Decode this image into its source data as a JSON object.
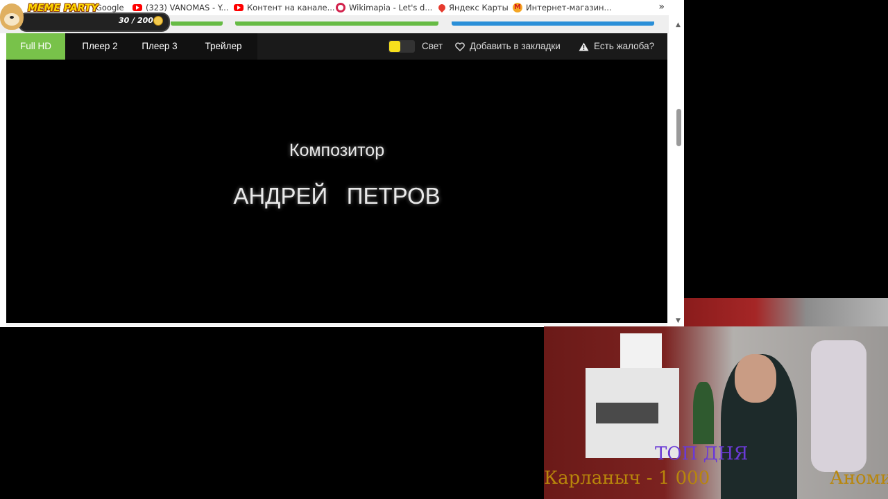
{
  "bookmarks": [
    {
      "label": "Google",
      "icon": "google-icon"
    },
    {
      "label": "(323) VANOMAS - Y...",
      "icon": "youtube-icon"
    },
    {
      "label": "Контент на канале...",
      "icon": "youtube-icon"
    },
    {
      "label": "Wikimapia - Let's d...",
      "icon": "wikimapia-icon"
    },
    {
      "label": "Яндекс Карты",
      "icon": "map-pin-icon"
    },
    {
      "label": "Интернет-магазин...",
      "icon": "store-icon"
    }
  ],
  "more_bookmarks_icon": "»",
  "meme_party": {
    "title": "MEME PARTY",
    "progress": "30 / 200"
  },
  "player_tabs": [
    {
      "label": "Full HD",
      "active": true
    },
    {
      "label": "Плеер 2",
      "active": false
    },
    {
      "label": "Плеер 3",
      "active": false
    },
    {
      "label": "Трейлер",
      "active": false
    }
  ],
  "controls": {
    "light_label": "Свет",
    "bookmark_label": "Добавить в закладки",
    "complaint_label": "Есть жалоба?"
  },
  "video": {
    "line1": "Композитор",
    "line2": "АНДРЕЙ   ПЕТРОВ"
  },
  "webcam_overlay": {
    "top_label": "ТОП ДНЯ",
    "donor_line": "Карланыч - 1 000",
    "right_fragment": "Аноми"
  },
  "colors": {
    "active_tab": "#78c24a",
    "toggle_knob": "#f7e01d",
    "top_label": "#6a3ad6",
    "donor_line": "#b8860b"
  }
}
